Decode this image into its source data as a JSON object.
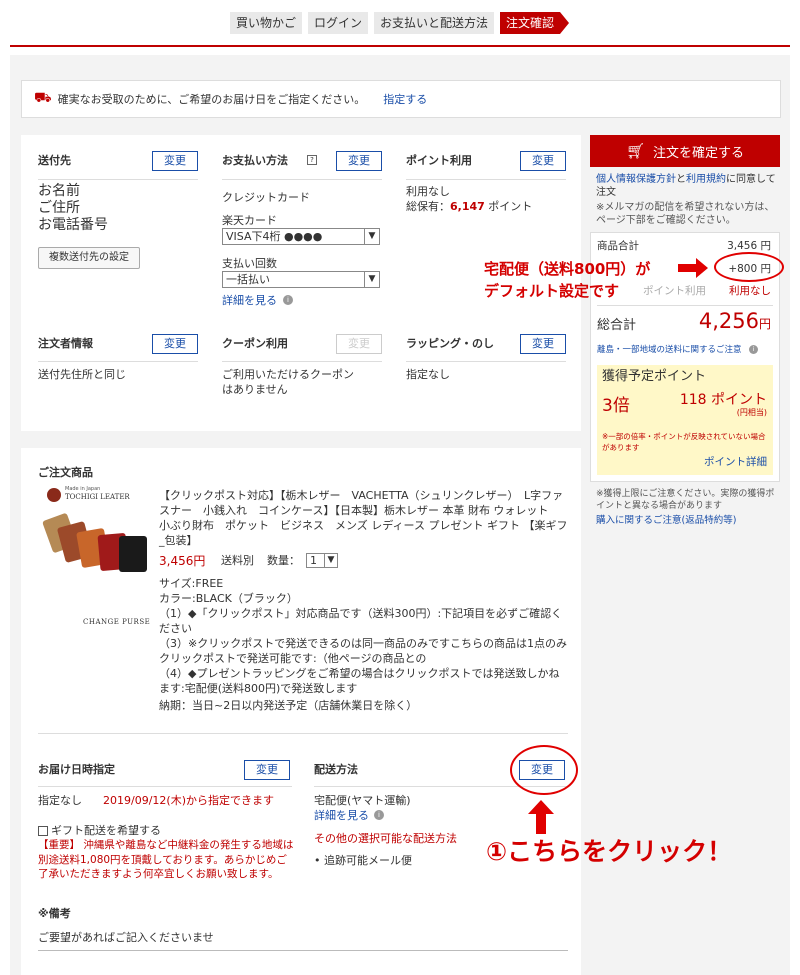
{
  "steps": [
    "買い物かご",
    "ログイン",
    "お支払いと配送方法",
    "注文確認"
  ],
  "notice": {
    "text": "確実なお受取のために、ご希望のお届け日をご指定ください。",
    "link": "指定する"
  },
  "shipping_to": {
    "title": "送付先",
    "change": "変更",
    "lines": [
      "お名前",
      "ご住所",
      "お電話番号"
    ],
    "multi_button": "複数送付先の設定"
  },
  "payment": {
    "title": "お支払い方法",
    "change": "変更",
    "method": "クレジットカード",
    "card_label": "楽天カード",
    "card_value": "VISA下4桁 ●●●●",
    "installment_label": "支払い回数",
    "installment_value": "一括払い",
    "details_link": "詳細を見る"
  },
  "points_use": {
    "title": "ポイント利用",
    "change": "変更",
    "status": "利用なし",
    "balance_label": "総保有：",
    "balance_value": "6,147",
    "balance_unit": "ポイント"
  },
  "orderer": {
    "title": "注文者情報",
    "change": "変更",
    "value": "送付先住所と同じ"
  },
  "coupon": {
    "title": "クーポン利用",
    "change": "変更",
    "value": "ご利用いただけるクーポンはありません"
  },
  "wrapping": {
    "title": "ラッピング・のし",
    "change": "変更",
    "value": "指定なし"
  },
  "product": {
    "section_title": "ご注文商品",
    "brand_top": "Made in Japan",
    "brand": "TOCHIGI LEATER",
    "caption": "CHANGE PURSE",
    "name": "【クリックポスト対応】【栃木レザー　VACHETTA（シュリンクレザー）　L字ファスナー　小銭入れ　コインケース】【日本製】栃木レザー 本革 財布 ウォレット　小ぶり財布　ポケット　ビジネス　メンズ レディース プレゼント ギフト 【楽ギフ_包装】",
    "price": "3,456円",
    "shipping": "送料別",
    "qty_label": "数量：",
    "qty": "1",
    "details": [
      "サイズ:FREE",
      "カラー:BLACK（ブラック）",
      "（1）◆「クリックポスト」対応商品です（送料300円）:下記項目を必ずご確認ください",
      "（3）※クリックポストで発送できるのは同一商品のみですこちらの商品は1点のみクリックポストで発送可能です:（他ページの商品との",
      "（4）◆プレゼントラッピングをご希望の場合はクリックポストでは発送致しかねます:宅配便(送料800円)で発送致します"
    ],
    "delivery": "納期：当日~2日以内発送予定（店舗休業日を除く）"
  },
  "delivery_date": {
    "title": "お届け日時指定",
    "change": "変更",
    "value": "指定なし",
    "available": "2019/09/12(木)から指定できます"
  },
  "delivery_method": {
    "title": "配送方法",
    "change": "変更",
    "value": "宅配便(ヤマト運輸)",
    "details_link": "詳細を見る",
    "other_label": "その他の選択可能な配送方法",
    "other_option": "追跡可能メール便"
  },
  "gift": {
    "label": "ギフト配送を希望する",
    "warning": "【重要】 沖縄県や離島など中継料金の発生する地域は別途送料1,080円を頂戴しております。あらかじめご了承いただきますよう何卒宜しくお願い致します。"
  },
  "remarks": {
    "title": "※備考",
    "text": "ご要望があればご記入くださいませ"
  },
  "sidebar": {
    "confirm_button": "注文を確定する",
    "agree_link": "個人情報保護方針",
    "agree_mid": "と",
    "agree_link2": "利用規約",
    "agree_text": "に同意して注文",
    "mailmag": "※メルマガの配信を希望されない方は、ページ下部をご確認ください。",
    "subtotal_label": "商品合計",
    "subtotal_value": "3,456 円",
    "shipping_value": "+800 円",
    "points_row_label": "ポイント利用",
    "points_row_value": "利用なし",
    "total_label": "総合計",
    "total_value": "4,256",
    "total_unit": "円",
    "island_note": "離島・一部地域の送料に関するご注意",
    "earn_label": "獲得予定ポイント",
    "multiplier": "3倍",
    "earn_value": "118 ポイント",
    "earn_unit": "(円相当)",
    "earn_note": "※一部の倍率・ポイントが反映されていない場合があります",
    "earn_details": "ポイント詳細",
    "cap_note": "※獲得上限にご注意ください。実際の獲得ポイントと異なる場合があります",
    "cap_link": "購入に関するご注意(返品特約等)"
  },
  "annotations": {
    "shipping_line1": "宅配便（送料800円）が",
    "shipping_line2": "デフォルト設定です",
    "click_here": "①こちらをクリック！"
  },
  "colors": {
    "brand_red": "#bf0000",
    "link_blue": "#1a4ea8",
    "annotation_red": "#e00000",
    "points_bg": "#fff8c8"
  }
}
